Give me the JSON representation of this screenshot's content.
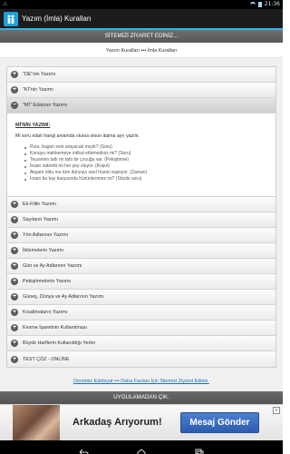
{
  "status_bar": {
    "left_text": "⚠",
    "time": "21:36"
  },
  "app": {
    "title": "Yazım (İmla) Kuralları",
    "icon": "app-logo-icon"
  },
  "visit_banner": {
    "label": "SİTEMİZİ ZİYARET EDİNİZ..."
  },
  "breadcrumb": {
    "text": "Yazım Kuralları ••• İmla Kuralları"
  },
  "accordion": {
    "items_top": [
      {
        "label": "\"DE\"nin Yazımı"
      },
      {
        "label": "\"Kİ\"nin Yazımı"
      }
    ],
    "active": {
      "label": "\"Mİ\" Edatının Yazımı"
    },
    "panel": {
      "title": "Mİ'NİN YAZIMI:",
      "intro": "Mi soru edatı hangi anlamda olursa olsun daima ayrı yazılır.",
      "examples": [
        "Rıza, bugün seni arayacak mıydı? (Soru)",
        "Konuyu  mahkemeye intikal ettirmediniz mi? (Soru)",
        "Teyzemin tatlı mı tatlı bir çocuğu var. (Pekiştirme)",
        "İnsan sabretti mi her şey oluyor. (Koşul)",
        "Akşam oldu mu tüm dünyayı sarıl hüzün kaplıyor. (Zaman)",
        "İnsan bu kay karşısında hüzünlenmez mi? (Sözde soru)"
      ]
    },
    "items_bottom": [
      {
        "label": "Ek-Fiilin Yazımı"
      },
      {
        "label": "Sayıların Yazımı"
      },
      {
        "label": "Yön Adlarının Yazımı"
      },
      {
        "label": "İkilemelerin Yazımı"
      },
      {
        "label": "Gün ve Ay Adlarının Yazımı"
      },
      {
        "label": "Pekiştirmelerin Yazımı"
      },
      {
        "label": "Güneş, Dünya ve Ay Adlarının Yazımı"
      },
      {
        "label": "Kısaltmaların Yazımı"
      },
      {
        "label": "Kesme İşaretinin Kullanılması"
      },
      {
        "label": "Büyük Harflerin Kullanıldığı Yerler"
      },
      {
        "label": "TEST ÇÖZ - ONLİNE"
      }
    ]
  },
  "footer_link": {
    "text": "Dersimiz Edebiyat ••• Daha Fazlası İçin Sitemizi Ziyaret Ediniz."
  },
  "exit_bar": {
    "label": "UYGULAMADAN ÇIK."
  },
  "ad": {
    "headline": "Arkadaş Arıyorum!",
    "button": "Mesaj Gönder",
    "close": "x"
  }
}
